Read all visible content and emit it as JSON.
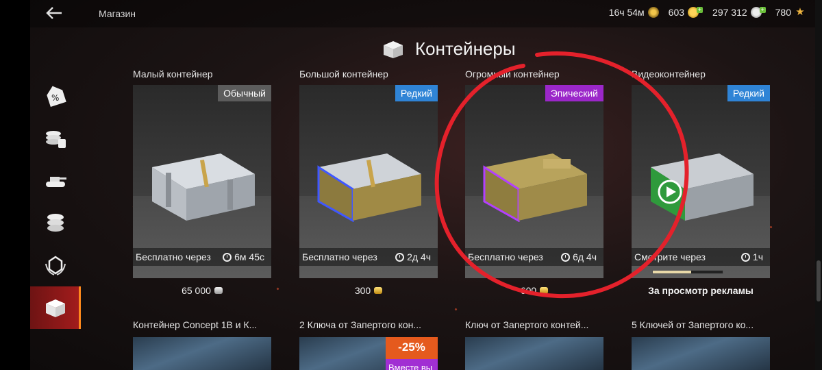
{
  "topbar": {
    "back_icon": "arrow-left-icon",
    "title": "Магазин",
    "premium_time": "16ч 54м",
    "gold": "603",
    "credits": "297 312",
    "free_exp": "780"
  },
  "heading": {
    "icon": "container-icon",
    "title": "Контейнеры"
  },
  "sidebar": {
    "items": [
      {
        "icon": "special-offers-icon"
      },
      {
        "icon": "currency-exchange-icon"
      },
      {
        "icon": "tank-icon"
      },
      {
        "icon": "coins-icon"
      },
      {
        "icon": "premium-account-icon"
      },
      {
        "icon": "containers-icon",
        "active": true
      }
    ]
  },
  "containers": [
    {
      "name": "Малый контейнер",
      "rarity": "Обычный",
      "timer_label": "Бесплатно через",
      "timer_value": "6м 45с",
      "price": "65 000",
      "currency": "credits"
    },
    {
      "name": "Большой контейнер",
      "rarity": "Редкий",
      "timer_label": "Бесплатно через",
      "timer_value": "2д 4ч",
      "price": "300",
      "currency": "gold"
    },
    {
      "name": "Огромный контейнер",
      "rarity": "Эпический",
      "timer_label": "Бесплатно через",
      "timer_value": "6д 4ч",
      "price": "600",
      "currency": "gold"
    },
    {
      "name": "Видеоконтейнер",
      "rarity": "Редкий",
      "timer_label": "Смотрите через",
      "timer_value": "1ч",
      "price_label": "За просмотр рекламы",
      "progress": 0.55
    }
  ],
  "bottom_row": [
    {
      "name": "Контейнер Concept 1B и К..."
    },
    {
      "name": "2 Ключа от Запертого кон...",
      "discount": "-25%",
      "bundle": "Вместе вы"
    },
    {
      "name": "Ключ от Запертого контей..."
    },
    {
      "name": "5 Ключей от Запертого ко..."
    }
  ],
  "colors": {
    "common": "#5c5c5c",
    "rare": "#2f84d6",
    "epic": "#9b27c9",
    "discount": "#e55a1d",
    "annotation": "#e4212b",
    "active_tab": "#ff8a1c"
  }
}
